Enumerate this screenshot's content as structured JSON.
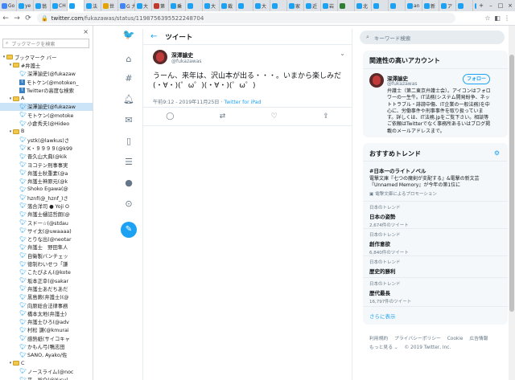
{
  "browser": {
    "tabs": [
      {
        "label": "Go",
        "color": "#4285f4"
      },
      {
        "label": "ye",
        "color": "#1da1f2"
      },
      {
        "label": "翁",
        "color": "#1da1f2"
      },
      {
        "label": "CH",
        "color": "#1da1f2"
      },
      {
        "label": "",
        "color": "#1da1f2",
        "active": true
      },
      {
        "label": "法",
        "color": "#1da1f2"
      },
      {
        "label": "世",
        "color": "#e4a400"
      },
      {
        "label": "G 大",
        "color": "#4285f4"
      },
      {
        "label": "大",
        "color": "#1da1f2"
      },
      {
        "label": "第",
        "color": "#c0392b"
      },
      {
        "label": "乗",
        "color": "#1da1f2"
      },
      {
        "label": "",
        "color": "#1da1f2"
      },
      {
        "label": "大",
        "color": "#1da1f2"
      },
      {
        "label": "裁",
        "color": "#1da1f2"
      },
      {
        "label": "",
        "color": "#1da1f2"
      },
      {
        "label": "大",
        "color": "#1da1f2"
      },
      {
        "label": "",
        "color": "#1da1f2"
      },
      {
        "label": "家",
        "color": "#1da1f2"
      },
      {
        "label": "近",
        "color": "#1da1f2"
      },
      {
        "label": "岩",
        "color": "#1da1f2"
      },
      {
        "label": "",
        "color": "#2e7d32"
      },
      {
        "label": "北",
        "color": "#1da1f2"
      },
      {
        "label": "",
        "color": "#1da1f2"
      },
      {
        "label": "",
        "color": "#1da1f2"
      },
      {
        "label": "an",
        "color": "#1da1f2"
      },
      {
        "label": "新",
        "color": "#1da1f2"
      },
      {
        "label": "ア",
        "color": "#1da1f2"
      },
      {
        "label": "",
        "color": "#1da1f2"
      },
      {
        "label": "レ",
        "color": "#1da1f2"
      },
      {
        "label": "",
        "color": "#1da1f2"
      }
    ],
    "url_host": "twitter.com",
    "url_path": "/fukazawas/status/1198756395522248704"
  },
  "sidebar": {
    "search_placeholder": "ブックマークを検索",
    "rows": [
      {
        "kind": "folder",
        "indent": 0,
        "open": true,
        "label": "ブックマーク バー"
      },
      {
        "kind": "folder",
        "indent": 1,
        "open": true,
        "label": "#弁護士"
      },
      {
        "kind": "twitter",
        "indent": 2,
        "label": "深澤諭史(@fukazaw"
      },
      {
        "kind": "site",
        "indent": 2,
        "label": "モトケン(@motoken_"
      },
      {
        "kind": "site",
        "indent": 2,
        "label": "Twitterの高度な検索"
      },
      {
        "kind": "folder",
        "indent": 1,
        "open": true,
        "label": "A"
      },
      {
        "kind": "twitter",
        "indent": 2,
        "label": "深澤諭史(@fukazaw",
        "selected": true
      },
      {
        "kind": "twitter",
        "indent": 2,
        "label": "モトケン(@motoke"
      },
      {
        "kind": "twitter",
        "indent": 2,
        "label": "小倉秀夫(@Hideo"
      },
      {
        "kind": "folder",
        "indent": 1,
        "open": true,
        "label": "B"
      },
      {
        "kind": "twitter",
        "indent": 2,
        "label": "ystk(@lawkus)さ"
      },
      {
        "kind": "twitter",
        "indent": 2,
        "label": "K・９９９９(@k99"
      },
      {
        "kind": "twitter",
        "indent": 2,
        "label": "晋久山大典(@kik"
      },
      {
        "kind": "twitter",
        "indent": 2,
        "label": "ヨコテン刑事事実"
      },
      {
        "kind": "twitter",
        "indent": 2,
        "label": "弁護士秋重素(@a"
      },
      {
        "kind": "twitter",
        "indent": 2,
        "label": "弁護士神原元(@k"
      },
      {
        "kind": "twitter",
        "indent": 2,
        "label": "Shoko Egawa(@"
      },
      {
        "kind": "twitter",
        "indent": 2,
        "label": "hznf(@_hznf_)さ"
      },
      {
        "kind": "twitter",
        "indent": 2,
        "label": "落合洋司 ● Yoji O"
      },
      {
        "kind": "twitter",
        "indent": 2,
        "label": "弁護士樋詰哲朗(@"
      },
      {
        "kind": "twitter",
        "indent": 2,
        "label": "スドー☆(@stdau"
      },
      {
        "kind": "twitter",
        "indent": 2,
        "label": "サイ太(@uwaaaa)"
      },
      {
        "kind": "twitter",
        "indent": 2,
        "label": "とりな出(@neotar"
      },
      {
        "kind": "twitter",
        "indent": 2,
        "label": "弁護士　野田隼人"
      },
      {
        "kind": "twitter",
        "indent": 2,
        "label": "自衛製バンチェッ"
      },
      {
        "kind": "twitter",
        "indent": 2,
        "label": "徳制わいせつ「謙"
      },
      {
        "kind": "twitter",
        "indent": 2,
        "label": "こたぴよん(@kote"
      },
      {
        "kind": "twitter",
        "indent": 2,
        "label": "坂本正幸(@sakar"
      },
      {
        "kind": "twitter",
        "indent": 2,
        "label": "弁護士あだちあだ"
      },
      {
        "kind": "twitter",
        "indent": 2,
        "label": "黒島蕨(弁護士)(@"
      },
      {
        "kind": "twitter",
        "indent": 2,
        "label": "向原総合法律事務"
      },
      {
        "kind": "twitter",
        "indent": 2,
        "label": "橋本太地(弁護士)"
      },
      {
        "kind": "twitter",
        "indent": 2,
        "label": "弁護士ひろ(@adv"
      },
      {
        "kind": "twitter",
        "indent": 2,
        "label": "村松 謙(@kmurai"
      },
      {
        "kind": "twitter",
        "indent": 2,
        "label": "感熱紙(サイコキャ"
      },
      {
        "kind": "twitter",
        "indent": 2,
        "label": "かもん弓(鴨志田"
      },
      {
        "kind": "twitter",
        "indent": 2,
        "label": "SANO, Ayako/佐"
      },
      {
        "kind": "folder",
        "indent": 1,
        "open": true,
        "label": "C"
      },
      {
        "kind": "twitter",
        "indent": 2,
        "label": "ノースライム(@noc"
      },
      {
        "kind": "twitter",
        "indent": 2,
        "label": "平　裕介(@Yusul"
      },
      {
        "kind": "twitter",
        "indent": 2,
        "label": "寺町東子(@teram"
      }
    ]
  },
  "nav_icons": [
    "twitter-logo-icon",
    "home-icon",
    "hashtag-icon",
    "bell-icon",
    "mail-icon",
    "bookmark-icon",
    "list-icon",
    "profile-icon",
    "more-icon"
  ],
  "header": {
    "back": "←",
    "title": "ツイート"
  },
  "tweet": {
    "name": "深澤諭史",
    "handle": "@fukazawas",
    "text": "うーん、来年は、沢山本が出る・・・。いまから楽しみだ(・∀・)(゜ω゜)(・∀・)(゜ω゜)",
    "time": "午前9:12 - 2019年11月25日",
    "client": "Twitter for iPad"
  },
  "right": {
    "search_placeholder": "キーワード検索",
    "related": {
      "heading": "関連性の高いアカウント",
      "name": "深澤諭史",
      "handle": "@fukazawas",
      "follow_label": "フォロー",
      "bio": "弁護士（第二東京弁護士会）。アイコンはフォロワーの一生牛。IT法務(システム開発紛争、ネットトラブル・誹謗中傷、IT企業の一般法務)を中心に、労働事件や刑事事件を取り扱っています。詳しくは、IT法務.jpをご覧下さい。相談等ご依頼はTwitterでなく事務所あるいはブログ掲載のメールアドレスまで。"
    },
    "trends": {
      "heading": "おすすめトレンド",
      "items": [
        {
          "name": "#日本一のライトノベル",
          "desc": "電撃文庫『七つの魔剣が支配する』&電撃の新文芸『Unnamed Memory』が今年の第1位に",
          "promo": "電撃文庫によるプロモーション"
        },
        {
          "ctx": "日本のトレンド",
          "name": "日本の姿勢",
          "count": "2,674件のツイート"
        },
        {
          "ctx": "日本のトレンド",
          "name": "創作意欲",
          "count": "6,840件のツイート"
        },
        {
          "ctx": "日本のトレンド",
          "name": "歴史的勝利"
        },
        {
          "ctx": "日本のトレンド",
          "name": "歴代最長",
          "count": "16,797件のツイート"
        }
      ],
      "more_label": "さらに表示"
    },
    "footer": {
      "links": [
        "利用規約",
        "プライバシーポリシー",
        "Cookie",
        "広告情報",
        "もっと見る ⌄"
      ],
      "copyright": "© 2019 Twitter, Inc."
    }
  }
}
